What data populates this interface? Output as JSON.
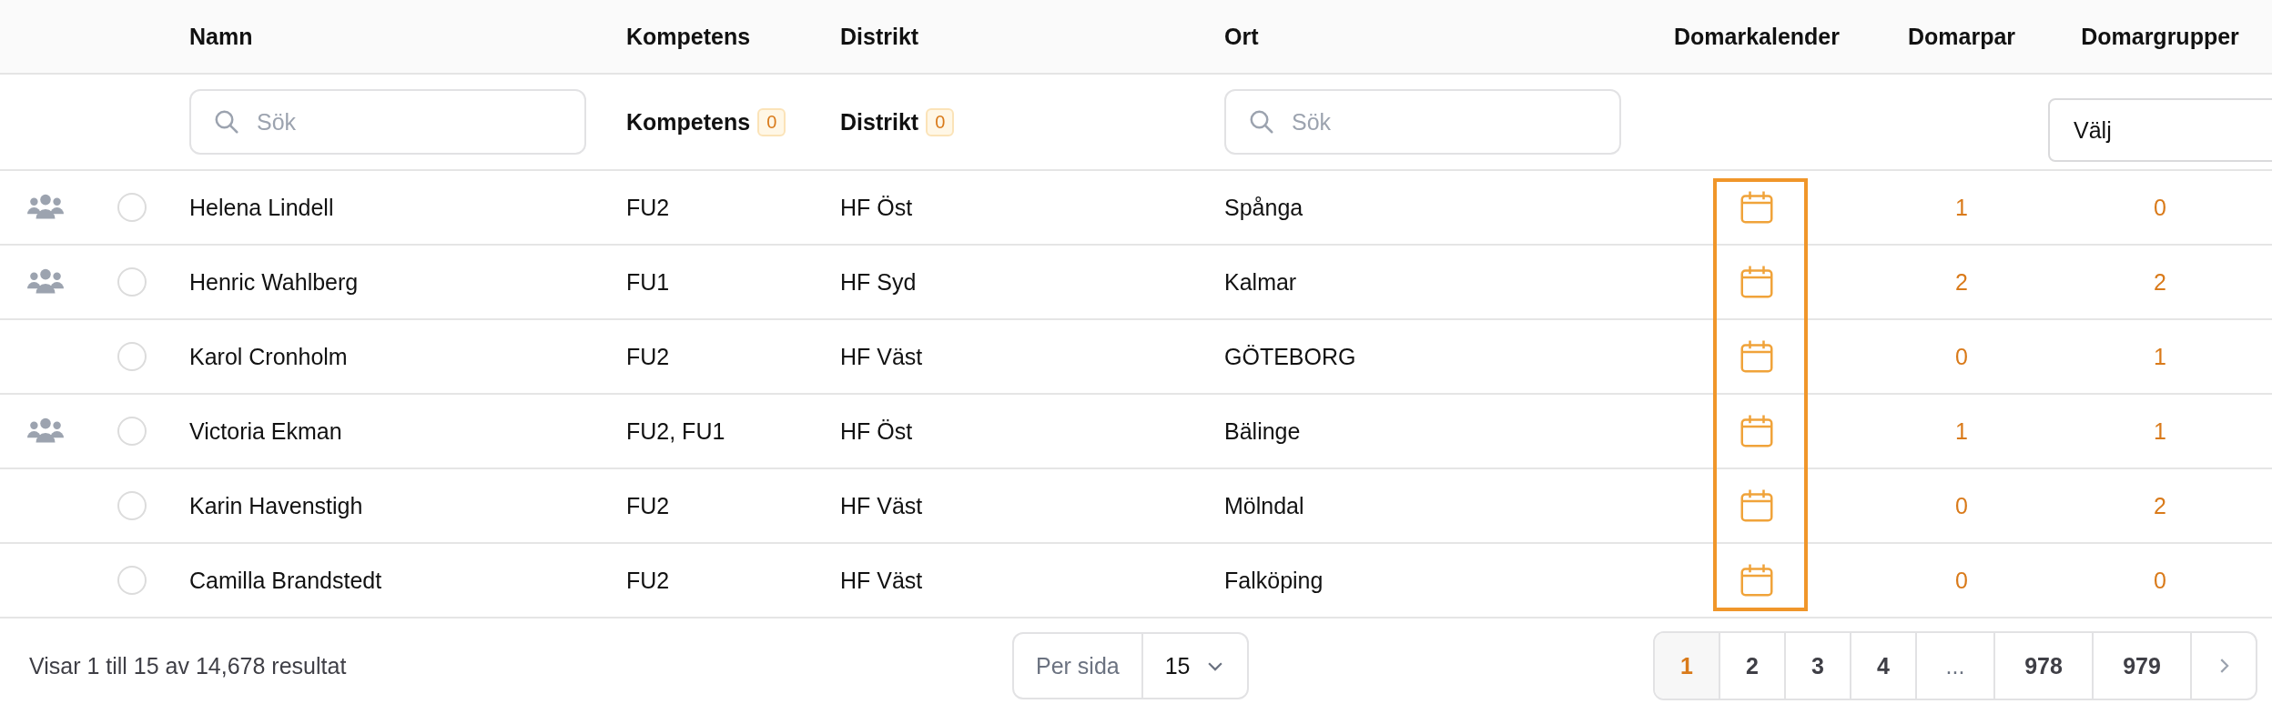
{
  "table": {
    "columns": [
      "Namn",
      "Kompetens",
      "Distrikt",
      "Ort",
      "Domarkalender",
      "Domarpar",
      "Domargrupper"
    ],
    "filters": {
      "name_search": {
        "placeholder": "Sök"
      },
      "kompetens": {
        "label": "Kompetens",
        "count": "0"
      },
      "distrikt": {
        "label": "Distrikt",
        "count": "0"
      },
      "ort_search": {
        "placeholder": "Sök"
      },
      "domargrupper_select": {
        "value": "Välj"
      }
    },
    "calendar_column_highlighted": true,
    "rows": [
      {
        "group_member": true,
        "selected": false,
        "name": "Helena Lindell",
        "kompetens": "FU2",
        "distrikt": "HF Öst",
        "ort": "Spånga",
        "domarpar": "1",
        "domargrupper": "0"
      },
      {
        "group_member": true,
        "selected": false,
        "name": "Henric Wahlberg",
        "kompetens": "FU1",
        "distrikt": "HF Syd",
        "ort": "Kalmar",
        "domarpar": "2",
        "domargrupper": "2"
      },
      {
        "group_member": false,
        "selected": false,
        "name": "Karol Cronholm",
        "kompetens": "FU2",
        "distrikt": "HF Väst",
        "ort": "GÖTEBORG",
        "domarpar": "0",
        "domargrupper": "1"
      },
      {
        "group_member": true,
        "selected": false,
        "name": "Victoria Ekman",
        "kompetens": "FU2, FU1",
        "distrikt": "HF Öst",
        "ort": "Bälinge",
        "domarpar": "1",
        "domargrupper": "1"
      },
      {
        "group_member": false,
        "selected": false,
        "name": "Karin Havenstigh",
        "kompetens": "FU2",
        "distrikt": "HF Väst",
        "ort": "Mölndal",
        "domarpar": "0",
        "domargrupper": "2"
      },
      {
        "group_member": false,
        "selected": false,
        "name": "Camilla Brandstedt",
        "kompetens": "FU2",
        "distrikt": "HF Väst",
        "ort": "Falköping",
        "domarpar": "0",
        "domargrupper": "0"
      }
    ]
  },
  "footer": {
    "summary": "Visar 1 till 15 av 14,678 resultat",
    "per_page": {
      "label": "Per sida",
      "value": "15"
    },
    "pages": [
      {
        "kind": "page",
        "label": "1",
        "selected": true
      },
      {
        "kind": "page",
        "label": "2",
        "selected": false
      },
      {
        "kind": "page",
        "label": "3",
        "selected": false
      },
      {
        "kind": "page",
        "label": "4",
        "selected": false
      },
      {
        "kind": "ellipsis",
        "label": "...",
        "selected": false
      },
      {
        "kind": "page",
        "label": "978",
        "selected": false
      },
      {
        "kind": "page",
        "label": "979",
        "selected": false
      },
      {
        "kind": "next"
      }
    ]
  }
}
